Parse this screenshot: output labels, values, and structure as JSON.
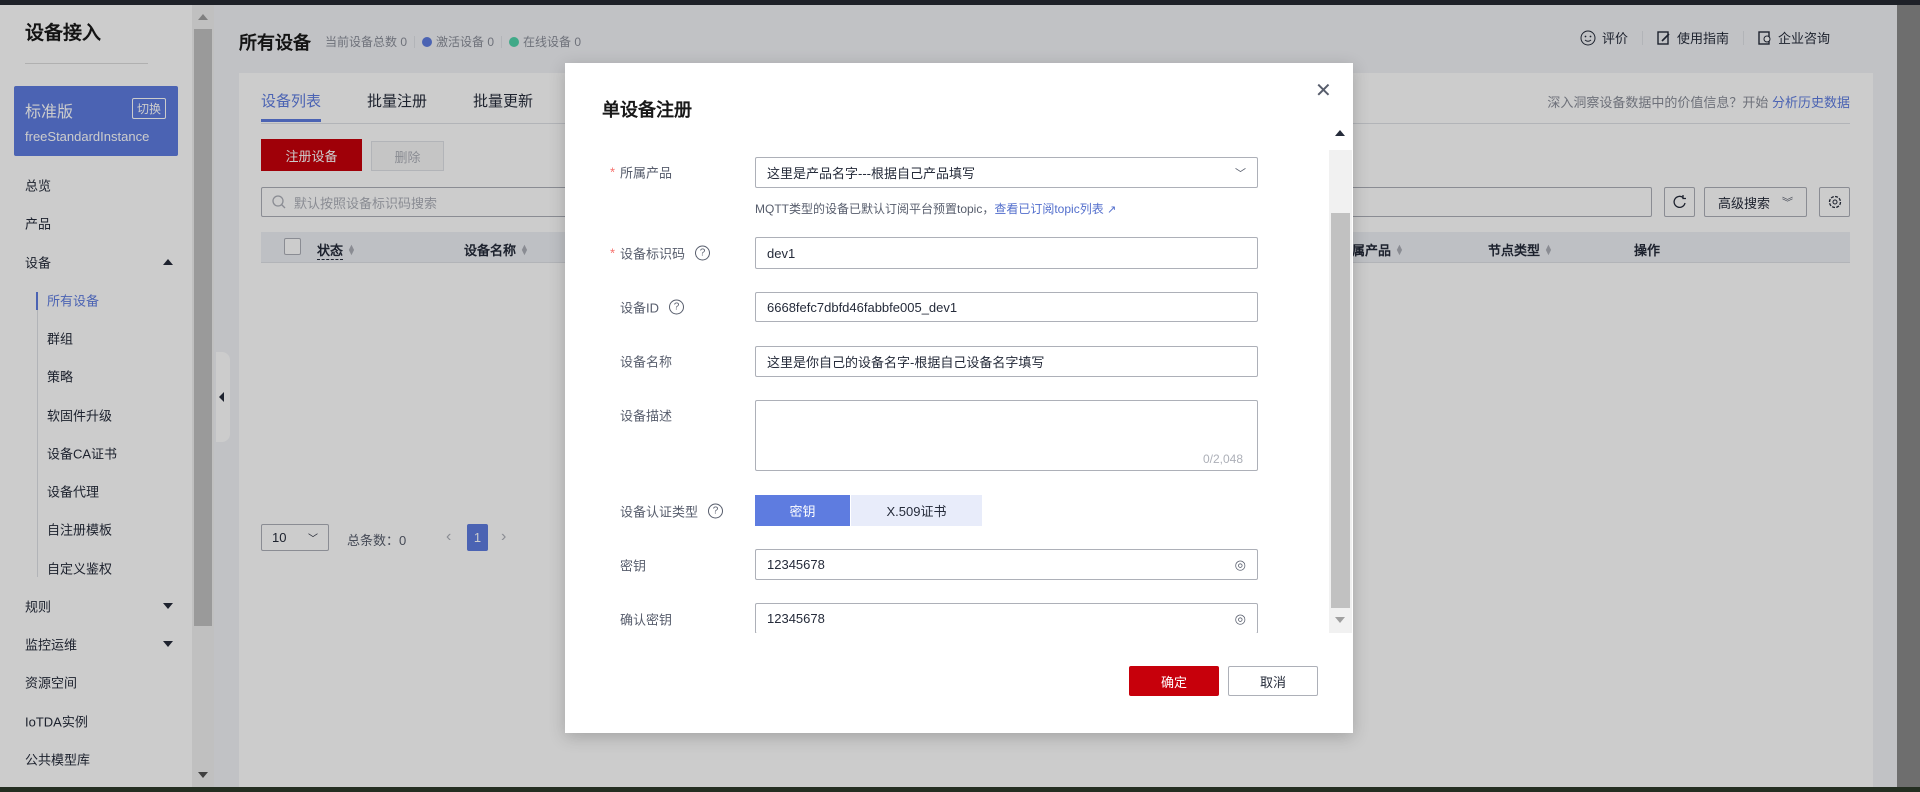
{
  "sidebar": {
    "title": "设备接入",
    "instance": {
      "edition": "标准版",
      "switch_label": "切换",
      "name": "freeStandardInstance"
    },
    "items": [
      {
        "label": "总览",
        "level": "top"
      },
      {
        "label": "产品",
        "level": "top"
      },
      {
        "label": "设备",
        "level": "top",
        "arrow": "up"
      },
      {
        "label": "所有设备",
        "level": "sub",
        "active": true
      },
      {
        "label": "群组",
        "level": "sub"
      },
      {
        "label": "策略",
        "level": "sub"
      },
      {
        "label": "软固件升级",
        "level": "sub"
      },
      {
        "label": "设备CA证书",
        "level": "sub"
      },
      {
        "label": "设备代理",
        "level": "sub"
      },
      {
        "label": "自注册模板",
        "level": "sub"
      },
      {
        "label": "自定义鉴权",
        "level": "sub"
      },
      {
        "label": "规则",
        "level": "top",
        "arrow": "down"
      },
      {
        "label": "监控运维",
        "level": "top",
        "arrow": "down"
      },
      {
        "label": "资源空间",
        "level": "top"
      },
      {
        "label": "IoTDA实例",
        "level": "top"
      },
      {
        "label": "公共模型库",
        "level": "top"
      }
    ]
  },
  "header": {
    "title": "所有设备",
    "stats": {
      "total": "当前设备总数 0",
      "active": "激活设备 0",
      "online": "在线设备 0"
    },
    "colors": {
      "active": "#5e7ce0",
      "online": "#50d4ab"
    },
    "links": {
      "rate": "评价",
      "guide": "使用指南",
      "consult": "企业咨询"
    }
  },
  "main": {
    "tabs": [
      "设备列表",
      "批量注册",
      "批量更新"
    ],
    "insight_text": "深入洞察设备数据中的价值信息？开始 ",
    "insight_link": "分析历史数据",
    "register_button": "注册设备",
    "delete_button": "删除",
    "search_placeholder": "默认按照设备标识码搜索",
    "advanced_search": "高级搜索",
    "columns": [
      "状态",
      "设备名称",
      "属产品",
      "节点类型",
      "操作"
    ],
    "pagination": {
      "page_size": "10",
      "total": "总条数：0",
      "current_page": "1"
    }
  },
  "dialog": {
    "title": "单设备注册",
    "product": {
      "label": "所属产品",
      "value": "这里是产品名字---根据自己产品填写"
    },
    "hint": "MQTT类型的设备已默认订阅平台预置topic，",
    "hint_link": "查看已订阅topic列表",
    "node_id": {
      "label": "设备标识码",
      "value": "dev1"
    },
    "device_id": {
      "label": "设备ID",
      "value": "6668fefc7dbfd46fabbfe005_dev1"
    },
    "device_name": {
      "label": "设备名称",
      "value": "这里是你自己的设备名字-根据自己设备名字填写"
    },
    "description": {
      "label": "设备描述",
      "value": "",
      "counter": "0/2,048"
    },
    "auth_type": {
      "label": "设备认证类型",
      "options": [
        "密钥",
        "X.509证书"
      ],
      "selected": "密钥"
    },
    "secret": {
      "label": "密钥",
      "value": "12345678"
    },
    "confirm_secret": {
      "label": "确认密钥",
      "value": "12345678"
    },
    "ok_button": "确定",
    "cancel_button": "取消"
  },
  "colors": {
    "brand_red": "#c7000b",
    "accent_blue": "#5e7ce0"
  }
}
